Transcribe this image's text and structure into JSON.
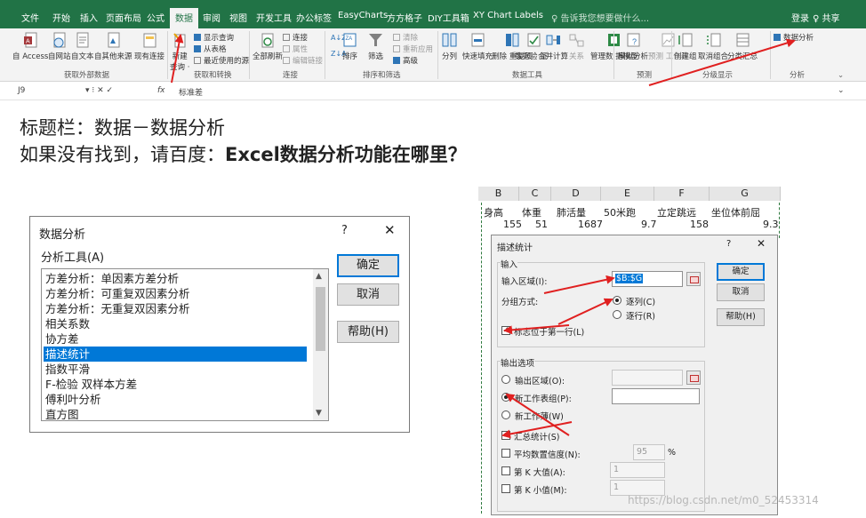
{
  "ribbon": {
    "tabs": [
      "文件",
      "开始",
      "插入",
      "页面布局",
      "公式",
      "数据",
      "审阅",
      "视图",
      "开发工具",
      "办公标签",
      "EasyCharts",
      "方方格子",
      "DIY工具箱",
      "XY Chart Labels"
    ],
    "active_tab": "数据",
    "tell_me": "♀ 告诉我您想要做什么...",
    "login": "登录",
    "share": "♀ 共享",
    "get_external": {
      "access": "自 Access",
      "web": "自网站",
      "text": "自文本",
      "other": "自其他来源",
      "existing": "现有连接",
      "group": "获取外部数据"
    },
    "get_transform": {
      "new_query": "新建",
      "query": "查询 ·",
      "show_query": "显示查询",
      "from_table": "从表格",
      "recent": "最近使用的源",
      "group": "获取和转换"
    },
    "connections": {
      "refresh_all": "全部刷新",
      "connections": "连接",
      "properties": "属性",
      "edit_links": "编辑链接",
      "group": "连接"
    },
    "sort_filter": {
      "sort": "排序",
      "filter": "筛选",
      "clear": "清除",
      "reapply": "重新应用",
      "advanced": "高级",
      "group": "排序和筛选"
    },
    "data_tools": {
      "split": "分列",
      "flash_fill": "快速填充",
      "remove_dup": "删除\n重复项",
      "validation": "数据验\n证 ·",
      "consolidate": "合并计算",
      "relations": "关系",
      "manage_model": "管理数\n据模型",
      "group": "数据工具"
    },
    "forecast": {
      "what_if": "模拟分析",
      "forecast_sheet": "预测\n工作表",
      "group": "预测"
    },
    "outline": {
      "group_btn": "创建组",
      "ungroup": "取消组合",
      "subtotal": "分类汇总",
      "group": "分级显示"
    },
    "analysis": {
      "data_analysis": "数据分析",
      "group": "分析"
    },
    "colors": {
      "green": "#217346",
      "ribbon_bg": "#f3f3f3"
    }
  },
  "formula_bar": {
    "name_box": "J9",
    "fx": "fx",
    "content": "标准差"
  },
  "instructions": {
    "line1": "标题栏：数据－数据分析",
    "line2_prefix": "如果没有找到，请百度：",
    "line2_bold": "Excel数据分析功能在哪里？"
  },
  "data_analysis_dialog": {
    "title": "数据分析",
    "help_q": "?",
    "close": "✕",
    "tools_label": "分析工具(A)",
    "items": [
      "方差分析：单因素方差分析",
      "方差分析：可重复双因素分析",
      "方差分析：无重复双因素分析",
      "相关系数",
      "协方差",
      "描述统计",
      "指数平滑",
      "F-检验 双样本方差",
      "傅利叶分析",
      "直方图"
    ],
    "selected": "描述统计",
    "ok": "确定",
    "cancel": "取消",
    "help": "帮助(H)"
  },
  "sheet": {
    "columns": [
      "B",
      "C",
      "D",
      "E",
      "F",
      "G"
    ],
    "headers": [
      "身高",
      "体重",
      "肺活量",
      "50米跑",
      "立定跳远",
      "坐位体前屈"
    ],
    "row1": [
      "155",
      "51",
      "1687",
      "9.7",
      "158",
      "9.3"
    ]
  },
  "desc_stats_dialog": {
    "title": "描述统计",
    "help_q": "?",
    "close": "✕",
    "input_section": "输入",
    "input_range_label": "输入区域(I):",
    "input_range_value": "$B:$G",
    "grouping_label": "分组方式:",
    "by_column": "逐列(C)",
    "by_row": "逐行(R)",
    "labels_first_row": "标志位于第一行(L)",
    "output_section": "输出选项",
    "output_range": "输出区域(O):",
    "new_worksheet_ply": "新工作表组(P):",
    "new_workbook": "新工作薄(W)",
    "summary_stats": "汇总统计(S)",
    "confidence_level": "平均数置信度(N):",
    "confidence_value": "95",
    "percent": "%",
    "kth_largest": "第 K 大值(A):",
    "kth_largest_value": "1",
    "kth_smallest": "第 K 小值(M):",
    "kth_smallest_value": "1",
    "ok": "确定",
    "cancel": "取消",
    "help": "帮助(H)",
    "check_mark": "✓"
  },
  "watermark": "https://blog.csdn.net/m0_52453314",
  "colors": {
    "arrow": "#e02020",
    "selection": "#0078d7"
  }
}
